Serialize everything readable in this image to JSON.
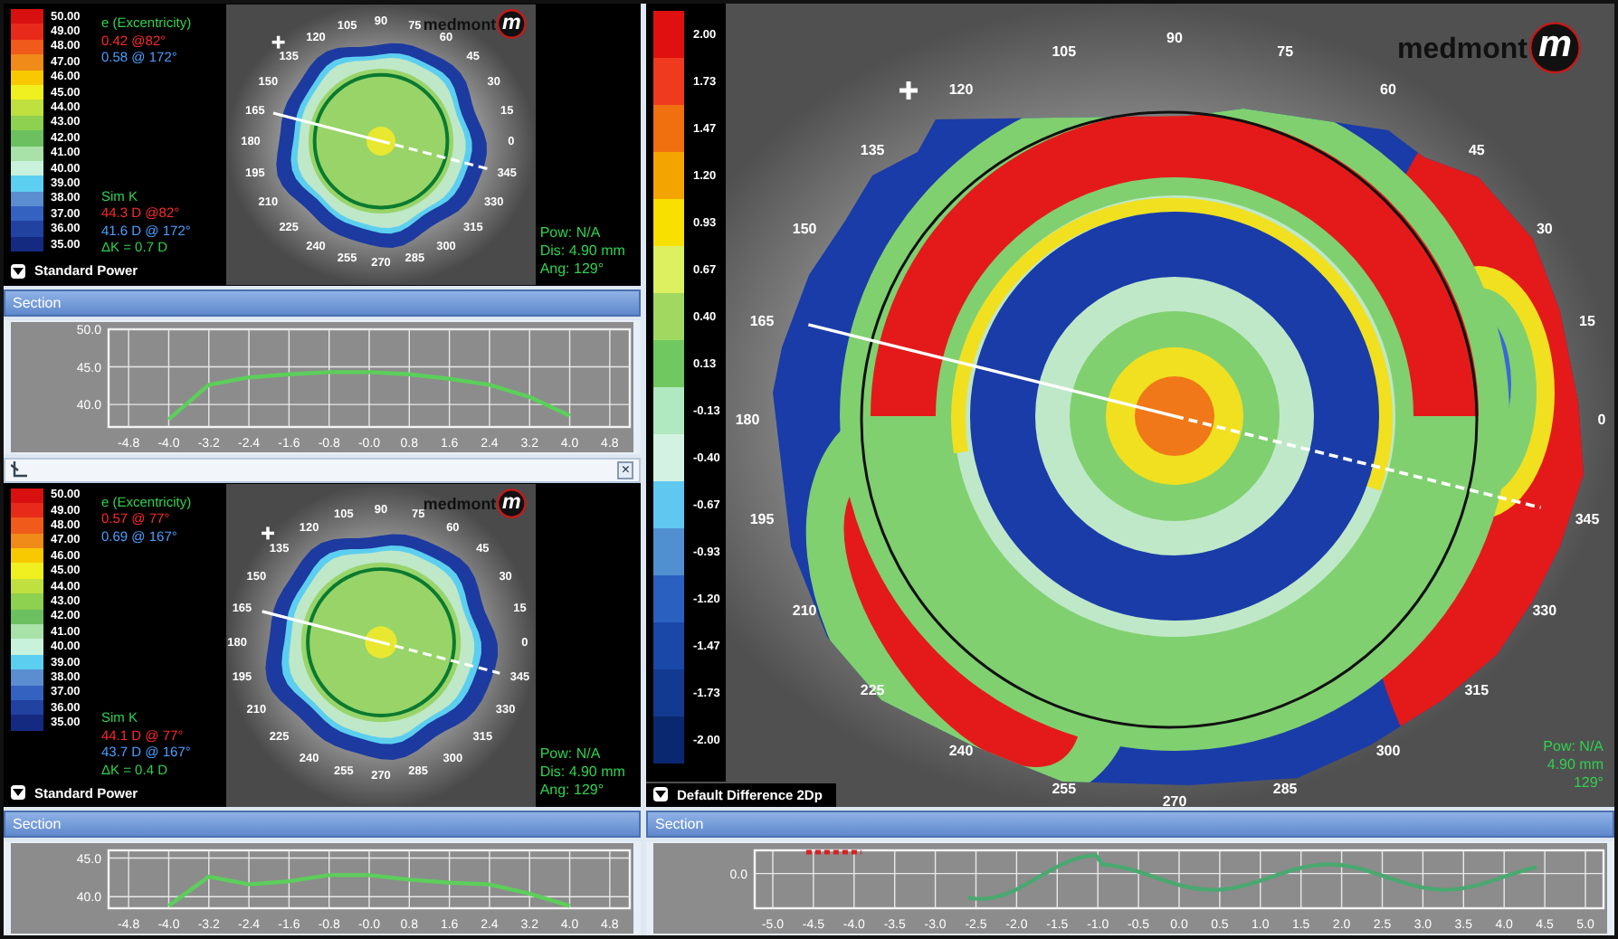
{
  "left_top": {
    "map": {
      "kind": "power",
      "legend": [
        {
          "label": "50.00",
          "color": "#d81010"
        },
        {
          "label": "49.00",
          "color": "#e82a1a"
        },
        {
          "label": "48.00",
          "color": "#f05a1a"
        },
        {
          "label": "47.00",
          "color": "#f08a18"
        },
        {
          "label": "46.00",
          "color": "#f8c800"
        },
        {
          "label": "45.00",
          "color": "#f0f020"
        },
        {
          "label": "44.00",
          "color": "#c0e040"
        },
        {
          "label": "43.00",
          "color": "#8ed050"
        },
        {
          "label": "42.00",
          "color": "#6cc060"
        },
        {
          "label": "41.00",
          "color": "#a8e2a8"
        },
        {
          "label": "40.00",
          "color": "#c8f2dc"
        },
        {
          "label": "39.00",
          "color": "#5ccff0"
        },
        {
          "label": "38.00",
          "color": "#5a8ed0"
        },
        {
          "label": "37.00",
          "color": "#3462c0"
        },
        {
          "label": "36.00",
          "color": "#2242a0"
        },
        {
          "label": "35.00",
          "color": "#142a80"
        }
      ],
      "eccentricity_title": "e (Excentricity)",
      "readings_top": [
        {
          "text": "0.42 @82°",
          "color": "#ff2a2a"
        },
        {
          "text": "0.58 @ 172°",
          "color": "#4aa0ff"
        }
      ],
      "simk_title": "Sim K",
      "readings_bottom": [
        {
          "text": "44.3 D @82°",
          "color": "#ff2a2a"
        },
        {
          "text": "41.6 D @ 172°",
          "color": "#4aa0ff"
        },
        {
          "text": "ΔK = 0.7 D",
          "color": "#30d050"
        }
      ],
      "info": [
        "Pow: N/A",
        "Dis: 4.90 mm",
        "Ang: 129°"
      ],
      "map_type": "Standard Power",
      "logo": "medmont",
      "logo_mark": "m",
      "angle_labels": [
        "90",
        "105",
        "75",
        "120",
        "60",
        "135",
        "45",
        "150",
        "30",
        "165",
        "15",
        "180",
        "0",
        "195",
        "345",
        "210",
        "330",
        "225",
        "315",
        "240",
        "300",
        "255",
        "285",
        "270"
      ]
    },
    "section": {
      "title": "Section",
      "chart_data": {
        "type": "line",
        "grid": true,
        "x": [
          -4.0,
          -3.2,
          -2.4,
          -1.6,
          -0.8,
          0.0,
          0.8,
          1.6,
          2.4,
          3.2,
          4.0
        ],
        "series": [
          {
            "color": "#5ccf5a",
            "values": [
              38.0,
              42.6,
              43.6,
              44.0,
              44.3,
              44.3,
              44.0,
              43.4,
              42.6,
              41.0,
              38.5
            ]
          }
        ],
        "xlim": [
          -5.2,
          5.2
        ],
        "ylim": [
          37,
          50
        ],
        "yticks": [
          {
            "value": 40,
            "label": "40.0"
          },
          {
            "value": 45,
            "label": "45.0"
          },
          {
            "value": 50,
            "label": "50.0"
          }
        ],
        "xticks": [
          {
            "value": -4.8,
            "label": "-4.8"
          },
          {
            "value": -4.0,
            "label": "-4.0"
          },
          {
            "value": -3.2,
            "label": "-3.2"
          },
          {
            "value": -2.4,
            "label": "-2.4"
          },
          {
            "value": -1.6,
            "label": "-1.6"
          },
          {
            "value": -0.8,
            "label": "-0.8"
          },
          {
            "value": 0,
            "label": "-0.0"
          },
          {
            "value": 0.8,
            "label": "0.8"
          },
          {
            "value": 1.6,
            "label": "1.6"
          },
          {
            "value": 2.4,
            "label": "2.4"
          },
          {
            "value": 3.2,
            "label": "3.2"
          },
          {
            "value": 4.0,
            "label": "4.0"
          },
          {
            "value": 4.8,
            "label": "4.8"
          }
        ]
      }
    }
  },
  "pane_bar": {
    "close_label": "×"
  },
  "left_bottom": {
    "map": {
      "kind": "power",
      "legend": [
        {
          "label": "50.00",
          "color": "#d81010"
        },
        {
          "label": "49.00",
          "color": "#e82a1a"
        },
        {
          "label": "48.00",
          "color": "#f05a1a"
        },
        {
          "label": "47.00",
          "color": "#f08a18"
        },
        {
          "label": "46.00",
          "color": "#f8c800"
        },
        {
          "label": "45.00",
          "color": "#f0f020"
        },
        {
          "label": "44.00",
          "color": "#c0e040"
        },
        {
          "label": "43.00",
          "color": "#8ed050"
        },
        {
          "label": "42.00",
          "color": "#6cc060"
        },
        {
          "label": "41.00",
          "color": "#a8e2a8"
        },
        {
          "label": "40.00",
          "color": "#c8f2dc"
        },
        {
          "label": "39.00",
          "color": "#5ccff0"
        },
        {
          "label": "38.00",
          "color": "#5a8ed0"
        },
        {
          "label": "37.00",
          "color": "#3462c0"
        },
        {
          "label": "36.00",
          "color": "#2242a0"
        },
        {
          "label": "35.00",
          "color": "#142a80"
        }
      ],
      "eccentricity_title": "e (Excentricity)",
      "readings_top": [
        {
          "text": "0.57 @ 77°",
          "color": "#ff2a2a"
        },
        {
          "text": "0.69 @ 167°",
          "color": "#4aa0ff"
        }
      ],
      "simk_title": "Sim K",
      "readings_bottom": [
        {
          "text": "44.1 D @ 77°",
          "color": "#ff2a2a"
        },
        {
          "text": "43.7 D @ 167°",
          "color": "#4aa0ff"
        },
        {
          "text": "ΔK = 0.4 D",
          "color": "#30d050"
        }
      ],
      "info": [
        "Pow: N/A",
        "Dis: 4.90 mm",
        "Ang: 129°"
      ],
      "map_type": "Standard Power",
      "logo": "medmont",
      "logo_mark": "m",
      "angle_labels": [
        "90",
        "105",
        "75",
        "120",
        "60",
        "135",
        "45",
        "150",
        "30",
        "165",
        "15",
        "180",
        "0",
        "195",
        "345",
        "210",
        "330",
        "225",
        "315",
        "240",
        "300",
        "255",
        "285",
        "270"
      ]
    },
    "section": {
      "title": "Section",
      "chart_data": {
        "type": "line",
        "grid": true,
        "x": [
          -4.0,
          -3.2,
          -2.4,
          -1.6,
          -0.8,
          0.0,
          0.8,
          1.6,
          2.4,
          3.2,
          4.0
        ],
        "series": [
          {
            "color": "#5ccf5a",
            "values": [
              38.8,
              42.6,
              41.6,
              42.0,
              42.8,
              42.8,
              42.2,
              41.8,
              41.6,
              40.4,
              38.8
            ]
          }
        ],
        "xlim": [
          -5.2,
          5.2
        ],
        "ylim": [
          38.5,
          46
        ],
        "yticks": [
          {
            "value": 40,
            "label": "40.0"
          },
          {
            "value": 45,
            "label": "45.0"
          }
        ],
        "xticks": [
          {
            "value": -4.8,
            "label": "-4.8"
          },
          {
            "value": -4.0,
            "label": "-4.0"
          },
          {
            "value": -3.2,
            "label": "-3.2"
          },
          {
            "value": -2.4,
            "label": "-2.4"
          },
          {
            "value": -1.6,
            "label": "-1.6"
          },
          {
            "value": -0.8,
            "label": "-0.8"
          },
          {
            "value": 0,
            "label": "-0.0"
          },
          {
            "value": 0.8,
            "label": "0.8"
          },
          {
            "value": 1.6,
            "label": "1.6"
          },
          {
            "value": 2.4,
            "label": "2.4"
          },
          {
            "value": 3.2,
            "label": "3.2"
          },
          {
            "value": 4.0,
            "label": "4.0"
          },
          {
            "value": 4.8,
            "label": "4.8"
          }
        ]
      }
    }
  },
  "right": {
    "map": {
      "kind": "difference",
      "legend": [
        {
          "label": "2.00",
          "color": "#e01010"
        },
        {
          "label": "1.73",
          "color": "#f03a20"
        },
        {
          "label": "1.47",
          "color": "#f07010"
        },
        {
          "label": "1.20",
          "color": "#f4a400"
        },
        {
          "label": "0.93",
          "color": "#f8e000"
        },
        {
          "label": "0.67",
          "color": "#dcf060"
        },
        {
          "label": "0.40",
          "color": "#a0d860"
        },
        {
          "label": "0.13",
          "color": "#70c860"
        },
        {
          "label": "-0.13",
          "color": "#b0e8c0"
        },
        {
          "label": "-0.40",
          "color": "#d4f2e4"
        },
        {
          "label": "-0.67",
          "color": "#60c8f0"
        },
        {
          "label": "-0.93",
          "color": "#5090d0"
        },
        {
          "label": "-1.20",
          "color": "#2a60c0"
        },
        {
          "label": "-1.47",
          "color": "#1a48a8"
        },
        {
          "label": "-1.73",
          "color": "#123a90"
        },
        {
          "label": "-2.00",
          "color": "#0a2870"
        }
      ],
      "info": [
        "Pow: N/A",
        "4.90 mm",
        "129°"
      ],
      "map_type": "Default Difference 2Dp",
      "logo": "medmont",
      "logo_mark": "m",
      "angle_labels": [
        "90",
        "105",
        "75",
        "120",
        "60",
        "135",
        "45",
        "150",
        "30",
        "165",
        "15",
        "180",
        "0",
        "195",
        "345",
        "210",
        "330",
        "225",
        "315",
        "240",
        "300",
        "255",
        "285",
        "270"
      ]
    },
    "section": {
      "title": "Section",
      "y_label": "0.0",
      "x_labels": [
        "-5.0",
        "-4.5",
        "-4.0",
        "-3.5",
        "-3.0",
        "-2.5",
        "-2.0",
        "-1.5",
        "-1.0",
        "-0.5",
        "0.0",
        "0.5",
        "1.0",
        "1.5",
        "2.0",
        "2.5",
        "3.0",
        "3.5",
        "4.0",
        "4.5",
        "5.0"
      ]
    }
  }
}
